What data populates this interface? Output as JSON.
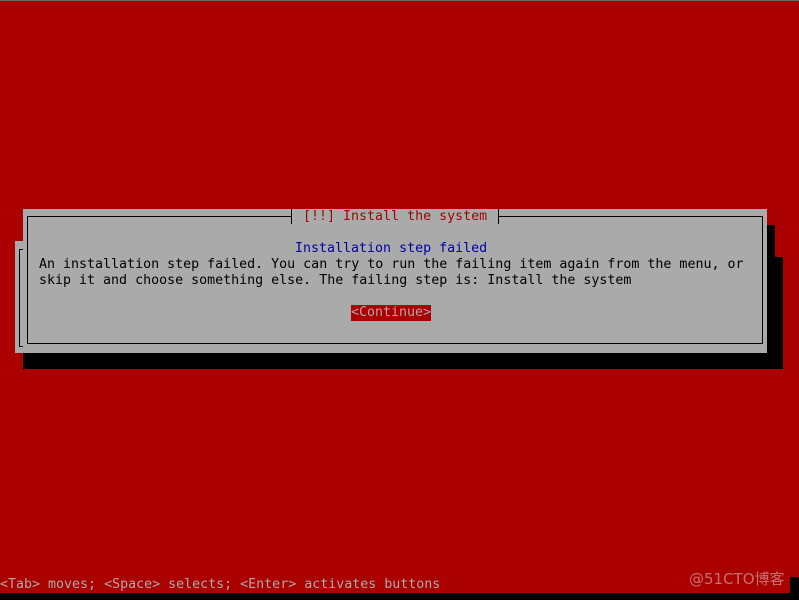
{
  "dialog": {
    "title": "[!!] Install the system",
    "subtitle": "Installation step failed",
    "message_lines": [
      "An installation step failed. You can try to run the failing item again from the menu, or",
      "skip it and choose something else. The failing step is: Install the system"
    ],
    "continue_button": "<Continue>"
  },
  "status_bar": {
    "help_text": "<Tab> moves; <Space> selects; <Enter> activates buttons"
  },
  "watermark": "@51CTO博客",
  "colors": {
    "background": "#aa0000",
    "dialog": "#aaaaaa",
    "title": "#aa0000",
    "subtitle": "#0000aa",
    "button_bg": "#aa0000",
    "shadow": "#000000"
  }
}
